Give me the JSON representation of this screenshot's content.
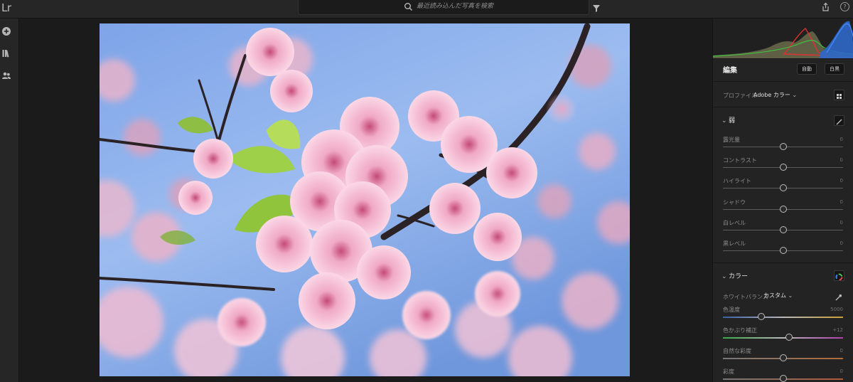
{
  "app": {
    "logo": "Lr"
  },
  "search": {
    "placeholder": "最近読み込んだ写真を検索"
  },
  "left_rail": {
    "icons": [
      "add-icon",
      "library-icon",
      "people-icon"
    ]
  },
  "photo": {
    "subject": "cherry blossoms against blue sky"
  },
  "edit": {
    "title": "編集",
    "auto_label": "自動",
    "bw_label": "白黒",
    "profile_label": "プロファイル",
    "profile_value": "Adobe カラー"
  },
  "light": {
    "title": "弱",
    "sliders": [
      {
        "label": "露光量",
        "value": "0",
        "position": 0.5
      },
      {
        "label": "コントラスト",
        "value": "0",
        "position": 0.5
      },
      {
        "label": "ハイライト",
        "value": "0",
        "position": 0.5
      },
      {
        "label": "シャドウ",
        "value": "0",
        "position": 0.5
      },
      {
        "label": "白レベル",
        "value": "0",
        "position": 0.5
      },
      {
        "label": "黒レベル",
        "value": "0",
        "position": 0.5
      }
    ]
  },
  "color": {
    "title": "カラー",
    "wb_label": "ホワイトバランス",
    "wb_value": "カスタム",
    "sliders": [
      {
        "label": "色温度",
        "value": "5000",
        "position": 0.32
      },
      {
        "label": "色かぶり補正",
        "value": "+12",
        "position": 0.55
      },
      {
        "label": "自然な彩度",
        "value": "0",
        "position": 0.5
      },
      {
        "label": "彩度",
        "value": "0",
        "position": 0.5
      }
    ]
  },
  "colors": {
    "background": "#1e1e1e",
    "panel": "#232323",
    "sky": "#7fa6e6",
    "blossom": "#f2b6cf"
  }
}
